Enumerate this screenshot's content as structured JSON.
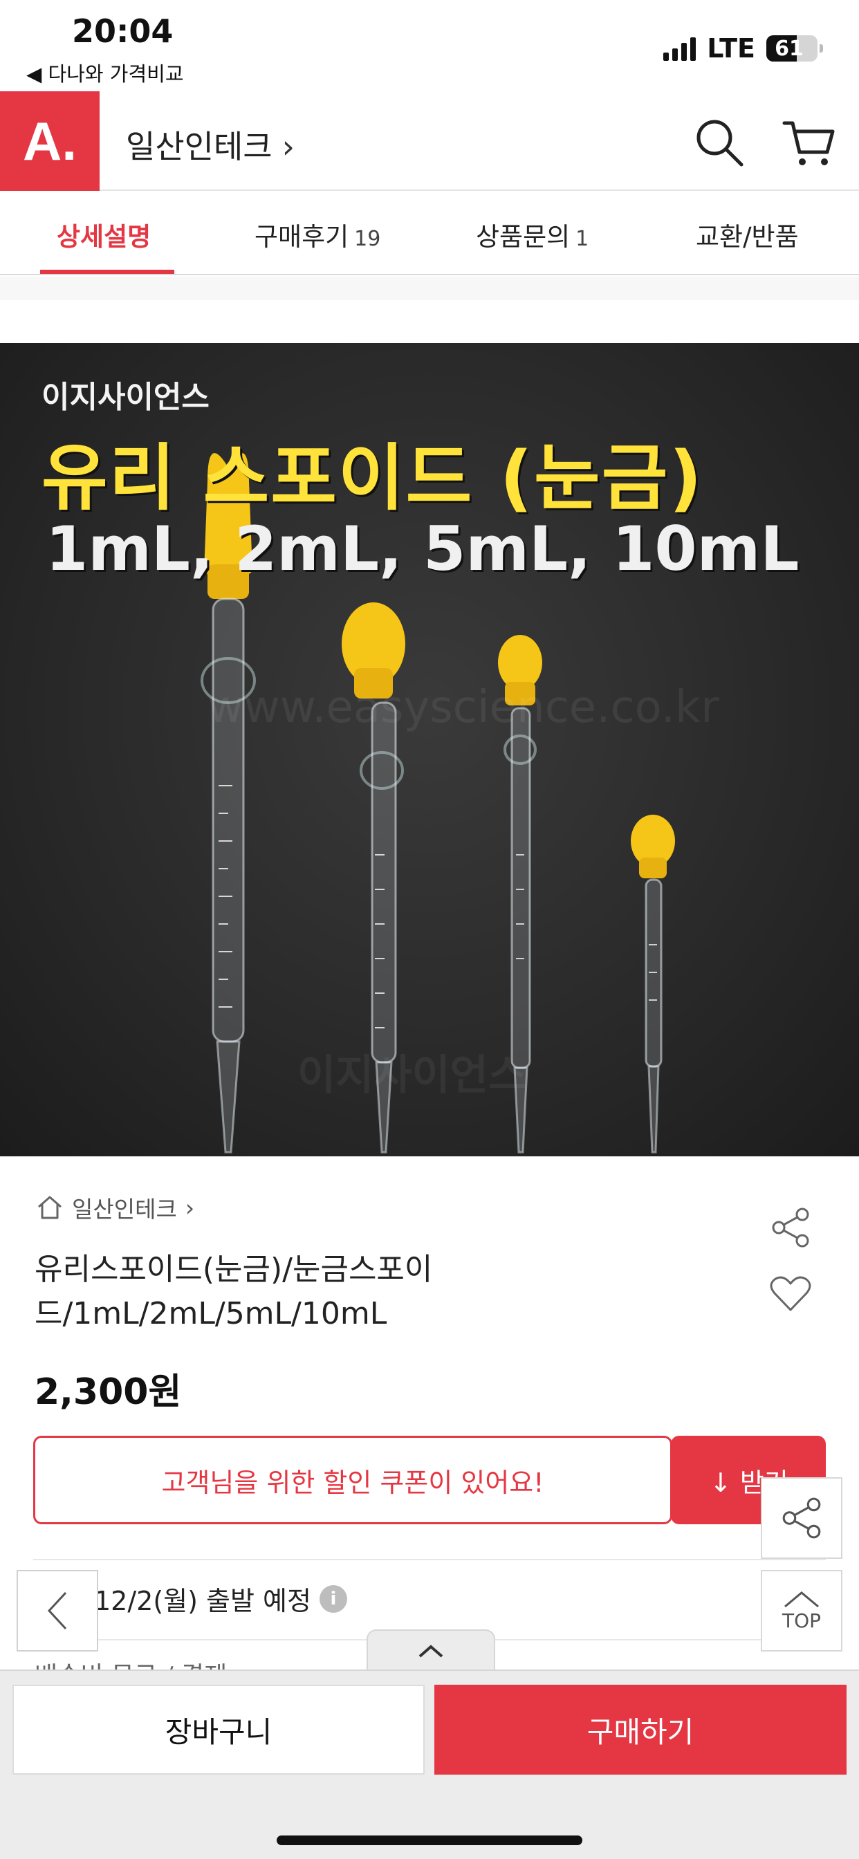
{
  "status_bar": {
    "time": "20:04",
    "back_app": "◀ 다나와 가격비교",
    "network": "LTE",
    "battery": "61"
  },
  "header": {
    "logo": "A.",
    "store_name": "일산인테크",
    "store_chevron": "›"
  },
  "tabs": [
    {
      "label": "상세설명",
      "count": ""
    },
    {
      "label": "구매후기",
      "count": "19"
    },
    {
      "label": "상품문의",
      "count": "1"
    },
    {
      "label": "교환/반품",
      "count": ""
    }
  ],
  "product_image": {
    "brand": "이지사이언스",
    "title": "유리 스포이드 (눈금)",
    "sizes": "1mL, 2mL, 5mL, 10mL",
    "watermark": "www.easyscience.co.kr",
    "watermark2": "이지사이언스"
  },
  "product": {
    "breadcrumb": "일산인테크",
    "breadcrumb_chevron": "›",
    "title": "유리스포이드(눈금)/눈금스포이드/1mL/2mL/5mL/10mL",
    "price": "2,300원"
  },
  "coupon": {
    "message": "고객님을 위한 할인 쿠폰이 있어요!",
    "button": "↓ 받기"
  },
  "shipping": {
    "text": "12/2(월) 출발 예정",
    "info": "i"
  },
  "partial_row": "배송비 무료 / 결제 ...",
  "floating": {
    "top_label": "TOP"
  },
  "bottom_bar": {
    "cart_label": "장바구니",
    "buy_label": "구매하기"
  },
  "colors": {
    "accent": "#e53743",
    "yellow": "#ffe23a"
  }
}
